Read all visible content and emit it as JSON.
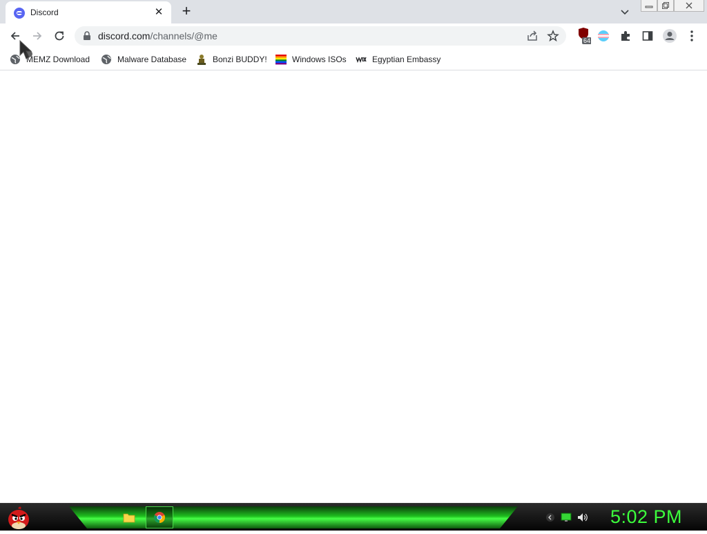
{
  "tab": {
    "title": "Discord",
    "favicon": "discord-icon"
  },
  "toolbar": {
    "url_domain": "discord.com",
    "url_path": "/channels/@me"
  },
  "bookmarks": [
    {
      "label": "MEMZ Download",
      "icon": "globe-icon"
    },
    {
      "label": "Malware Database",
      "icon": "globe-icon"
    },
    {
      "label": "Bonzi BUDDY!",
      "icon": "bonzi-icon"
    },
    {
      "label": "Windows ISOs",
      "icon": "rainbow-flag-icon"
    },
    {
      "label": "Egyptian Embassy",
      "icon": "wix-icon"
    }
  ],
  "extensions": {
    "badge": "64"
  },
  "taskbar": {
    "clock": "5:02 PM"
  },
  "colors": {
    "clock": "#3cff3c",
    "discord": "#5865f2",
    "taskbar_green": "#1fbf1f"
  }
}
